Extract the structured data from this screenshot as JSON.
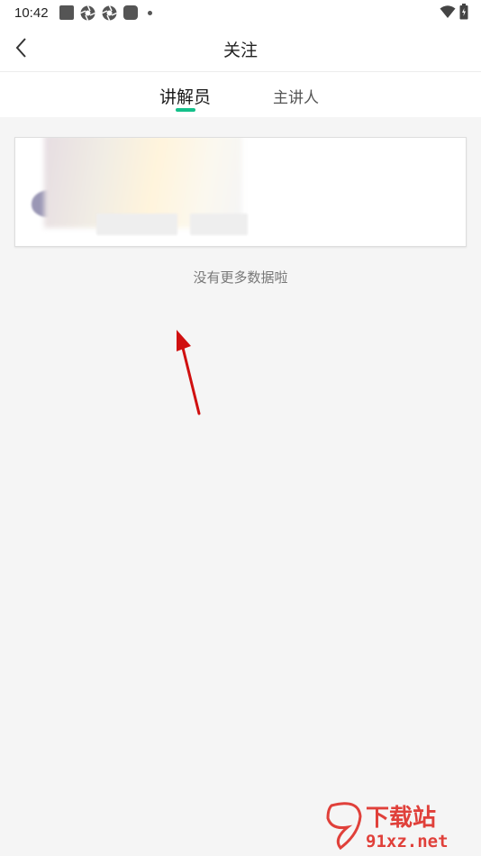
{
  "status_bar": {
    "time": "10:42"
  },
  "app_bar": {
    "title": "关注"
  },
  "tabs": [
    {
      "label": "讲解员",
      "active": true
    },
    {
      "label": "主讲人",
      "active": false
    }
  ],
  "list": {
    "end_text": "没有更多数据啦"
  },
  "watermark": {
    "brand": "下载站",
    "site": "91xz.net"
  },
  "colors": {
    "accent": "#14c08a",
    "arrow": "#d01010",
    "watermark": "#e0403a"
  },
  "icons": [
    "back-chevron-icon",
    "wifi-icon",
    "battery-icon"
  ]
}
